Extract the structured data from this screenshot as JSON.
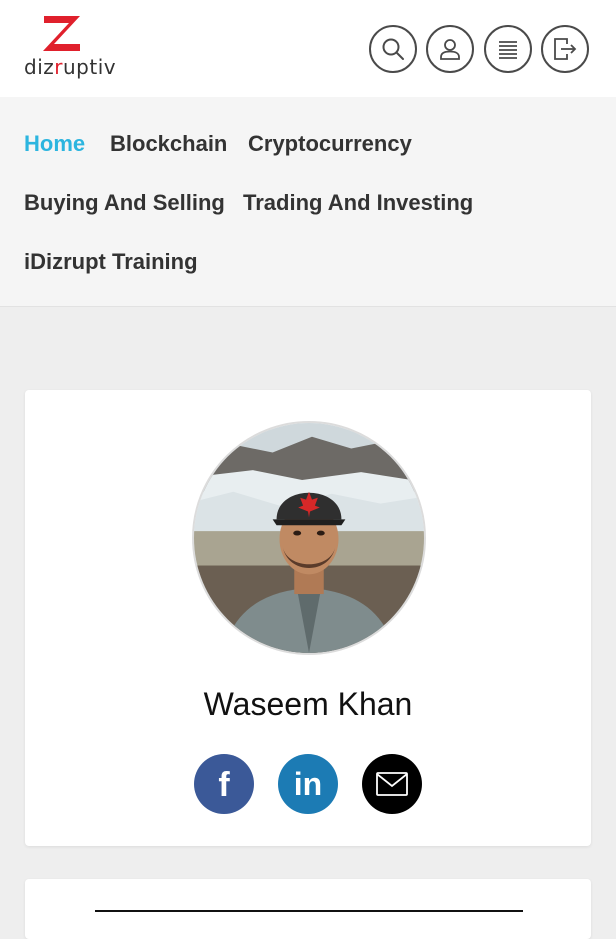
{
  "header": {
    "logo": {
      "text_prefix": "diz",
      "text_accent": "r",
      "text_suffix": "uptiv",
      "brand_color": "#e0202c"
    },
    "actions": [
      {
        "name": "search",
        "icon": "search-icon"
      },
      {
        "name": "account",
        "icon": "user-icon"
      },
      {
        "name": "menu",
        "icon": "hamburger-menu-icon"
      },
      {
        "name": "logout",
        "icon": "logout-icon"
      }
    ]
  },
  "nav": {
    "accent_color": "#2cb5df",
    "items": [
      {
        "label": "Home",
        "active": true
      },
      {
        "label": "Blockchain",
        "active": false
      },
      {
        "label": "Cryptocurrency",
        "active": false
      },
      {
        "label": "Buying And Selling",
        "active": false
      },
      {
        "label": "Trading And Investing",
        "active": false
      },
      {
        "label": "iDizrupt Training",
        "active": false
      }
    ]
  },
  "profile": {
    "name": "Waseem Khan",
    "avatar": "profile-photo",
    "social": [
      {
        "network": "facebook",
        "glyph": "f",
        "color": "#3b5998"
      },
      {
        "network": "linkedin",
        "glyph": "in",
        "color": "#1c7bb4"
      },
      {
        "network": "email",
        "icon": "envelope-icon",
        "color": "#000000"
      }
    ]
  }
}
